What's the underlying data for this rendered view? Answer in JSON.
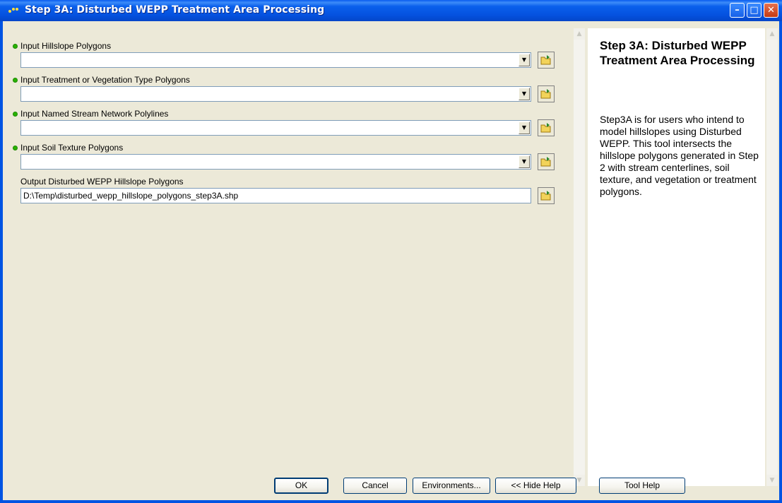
{
  "window": {
    "title": "Step 3A: Disturbed WEPP Treatment Area Processing",
    "controls": [
      "minimize-icon",
      "maximize-icon",
      "close-icon"
    ]
  },
  "params": [
    {
      "label": "Input Hillslope Polygons",
      "value": "",
      "required": true,
      "type": "combo"
    },
    {
      "label": "Input Treatment or Vegetation Type Polygons",
      "value": "",
      "required": true,
      "type": "combo"
    },
    {
      "label": "Input Named Stream Network Polylines",
      "value": "",
      "required": true,
      "type": "combo"
    },
    {
      "label": "Input Soil Texture Polygons",
      "value": "",
      "required": true,
      "type": "combo"
    },
    {
      "label": "Output Disturbed WEPP Hillslope Polygons",
      "value": "D:\\Temp\\disturbed_wepp_hillslope_polygons_step3A.shp",
      "required": false,
      "type": "text"
    }
  ],
  "help": {
    "title": "Step 3A: Disturbed WEPP Treatment Area Processing",
    "body": "Step3A is for users who intend to model hillslopes using Disturbed WEPP. This tool intersects the hillslope polygons generated in Step 2 with stream centerlines, soil texture, and vegetation or treatment polygons."
  },
  "buttons": {
    "ok": "OK",
    "cancel": "Cancel",
    "environments": "Environments...",
    "hide_help": "<< Hide Help",
    "tool_help": "Tool Help"
  },
  "colors": {
    "titlebar": "#0054e3",
    "required_dot": "#29b200",
    "dialog_bg": "#ece9d8"
  }
}
